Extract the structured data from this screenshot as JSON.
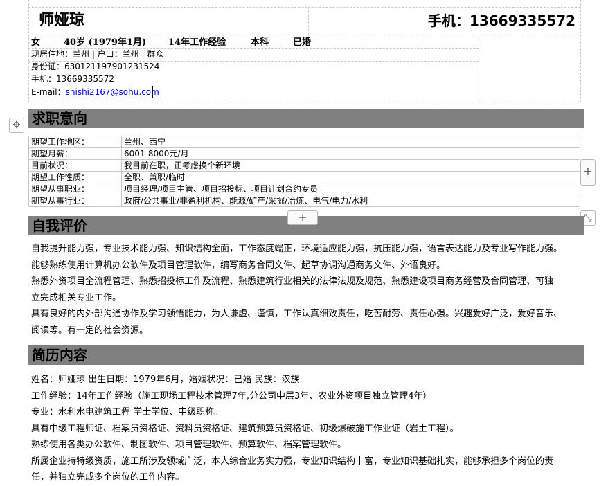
{
  "header": {
    "name": "师娅琼",
    "phone_title": "手机：13669335572"
  },
  "personal": {
    "gender": "女",
    "age": "40岁 (1979年1月)",
    "experience": "14年工作经验",
    "education": "本科",
    "marital": "已婚",
    "residence": "现居住地：兰州 | 户口：兰州 | 群众",
    "id_card": "身份证：630121197901231524",
    "mobile": "手机：13669335572",
    "email_label": "E-mail：",
    "email": "shishi2167@sohu.com"
  },
  "sections": {
    "intent": "求职意向",
    "self_eval": "自我评价",
    "resume": "简历内容"
  },
  "intent_rows": [
    {
      "key": "期望工作地区：",
      "value": "兰州、西宁"
    },
    {
      "key": "期望月薪：",
      "value": "6001-8000元/月"
    },
    {
      "key": "目前状况：",
      "value": "我目前在职，正考虑换个新环境"
    },
    {
      "key": "期望工作性质：",
      "value": "全职、兼职/临时"
    },
    {
      "key": "期望从事职业：",
      "value": "项目经理/项目主管、项目招投标、项目计划合约专员"
    },
    {
      "key": "期望从事行业：",
      "value": "政府/公共事业/非盈利机构、能源/矿产/采掘/冶炼、电气/电力/水利"
    }
  ],
  "self_eval_lines": [
    "自我提升能力强，专业技术能力强、知识结构全面，工作态度端正，环境适应能力强，抗压能力强，语言表达能力及专业写作能力强。",
    "能够熟练使用计算机办公软件及项目管理软件，编写商务合同文件、起草协调沟通商务文件、外语良好。",
    "熟悉外资项目全流程管理、熟悉招投标工作及流程、熟悉建筑行业相关的法律法规及规范、熟悉建设项目商务经营及合同管理、可独",
    "立完成相关专业工作。",
    "具有良好的内外部沟通协作及学习领悟能力，为人谦虚、谨慎，工作认真细致责任，吃苦耐劳、责任心强。兴趣爱好广泛，爱好音乐、",
    "阅读等。有一定的社会资源。"
  ],
  "resume_lines": [
    "姓名：师娅琼  出生日期：1979年6月，婚姻状况：已婚  民族：汉族",
    "工作经验：14年工作经验（施工现场工程技术管理7年,分公司中层3年、农业外资项目独立管理4年）",
    "专业：水利水电建筑工程  学士学位、中级职称。",
    "具有中级工程师证、档案员资格证、资料员资格证、建筑预算员资格证、初级爆破施工作业证（岩土工程）。",
    "熟练使用各类办公软件、制图软件、项目管理软件、预算软件、档案管理软件。",
    "所属企业持特级资质，施工所涉及领域广泛，本人综合业务实力强，专业知识结构丰富，专业知识基础扎实，能够承担多个岗位的责",
    "任，并独立完成多个岗位的工作内容。"
  ],
  "controls": {
    "move_handle": "✥",
    "add_row": "+",
    "add_col": "+",
    "resize": "⤡"
  }
}
